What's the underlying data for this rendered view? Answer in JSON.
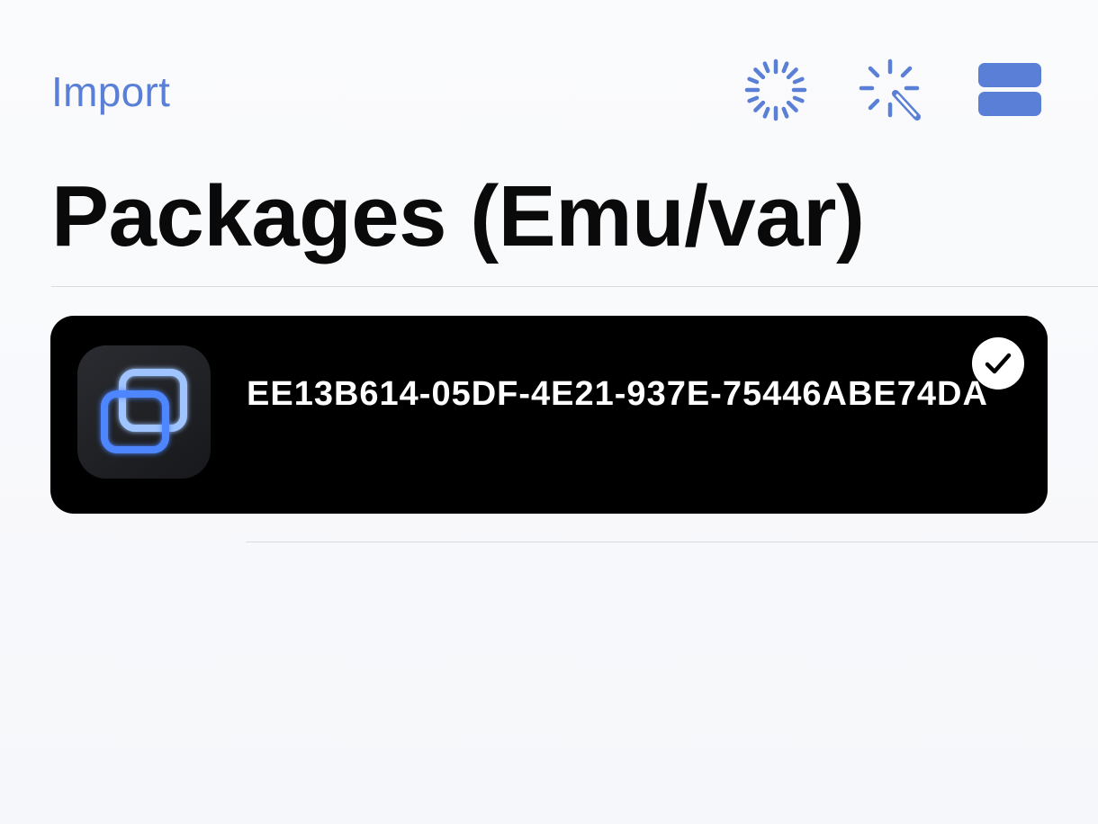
{
  "nav": {
    "import_label": "Import",
    "icons": [
      "spinner-icon",
      "magic-wand-icon",
      "list-view-icon"
    ],
    "accent_color": "#5a7fd6"
  },
  "title": "Packages (Emu/var)",
  "packages": [
    {
      "name": "EE13B614-05DF-4E21-937E-75446ABE74DA",
      "selected": true,
      "icon": "overlapping-squares-app-icon"
    }
  ],
  "colors": {
    "background": "#f7f8fb",
    "row_background": "#000000",
    "row_text": "#ffffff",
    "title_text": "#0a0a0a"
  }
}
